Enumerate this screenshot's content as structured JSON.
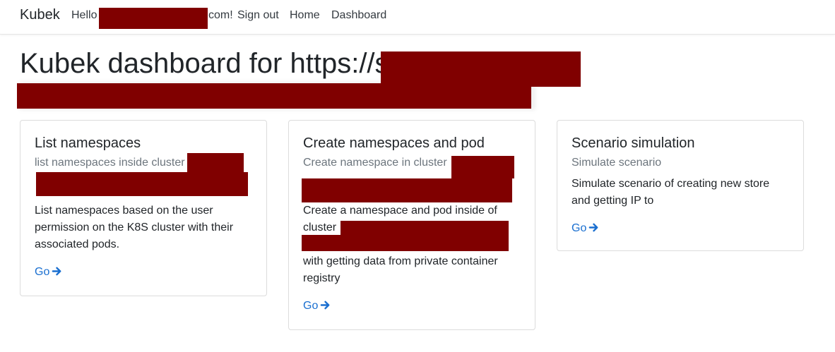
{
  "navbar": {
    "brand": "Kubek",
    "hello_prefix": "Hello",
    "hello_suffix": "com!",
    "sign_out": "Sign out",
    "home": "Home",
    "dashboard": "Dashboard"
  },
  "page": {
    "title": "Kubek dashboard for https://s"
  },
  "cards": [
    {
      "title": "List namespaces",
      "subtitle": "list namespaces inside cluster",
      "text": "List namespaces based on the user permission on the K8S cluster with their associated pods.",
      "link": "Go"
    },
    {
      "title": "Create namespaces and pod",
      "subtitle": "Create namespace in cluster",
      "text_a": "Create a namespace and pod inside of cluster",
      "text_b": "with getting data from private container registry",
      "link": "Go"
    },
    {
      "title": "Scenario simulation",
      "subtitle": "Simulate scenario",
      "text": "Simulate scenario of creating new store and getting IP to",
      "link": "Go"
    }
  ],
  "colors": {
    "redaction": "#800000",
    "link": "#1a6fd0",
    "muted": "#6c757d"
  },
  "icons": {
    "go_arrow": "arrow-right-icon"
  }
}
